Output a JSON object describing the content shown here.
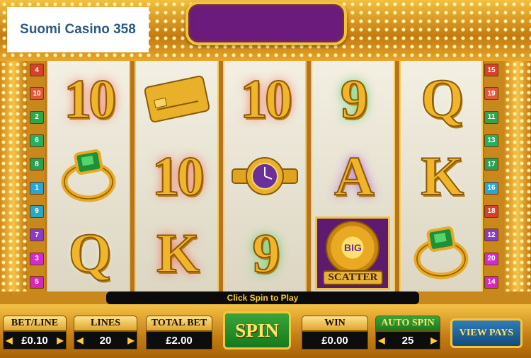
{
  "brand": "Suomi Casino 358",
  "lines_left": [
    {
      "n": "4",
      "color": "#d9402c"
    },
    {
      "n": "10",
      "color": "#e05a3a"
    },
    {
      "n": "2",
      "color": "#2ca84a"
    },
    {
      "n": "6",
      "color": "#24b060"
    },
    {
      "n": "8",
      "color": "#2aa050"
    },
    {
      "n": "1",
      "color": "#2aa6d6"
    },
    {
      "n": "9",
      "color": "#2aa6c6"
    },
    {
      "n": "7",
      "color": "#8a3cc8"
    },
    {
      "n": "3",
      "color": "#d42ad4"
    },
    {
      "n": "5",
      "color": "#d42ab8"
    }
  ],
  "lines_right": [
    {
      "n": "15",
      "color": "#d9402c"
    },
    {
      "n": "19",
      "color": "#e05a3a"
    },
    {
      "n": "11",
      "color": "#2ca84a"
    },
    {
      "n": "13",
      "color": "#24b060"
    },
    {
      "n": "17",
      "color": "#2aa050"
    },
    {
      "n": "16",
      "color": "#2aa6d6"
    },
    {
      "n": "18",
      "color": "#d9402c"
    },
    {
      "n": "12",
      "color": "#8a3cc8"
    },
    {
      "n": "20",
      "color": "#d42ad4"
    },
    {
      "n": "14",
      "color": "#d42ab8"
    }
  ],
  "reels": [
    [
      {
        "sym": "10",
        "glow": "red"
      },
      {
        "sym": "ring"
      },
      {
        "sym": "Q",
        "glow": ""
      }
    ],
    [
      {
        "sym": "card"
      },
      {
        "sym": "10",
        "glow": "red"
      },
      {
        "sym": "K",
        "glow": "red"
      }
    ],
    [
      {
        "sym": "10",
        "glow": "red"
      },
      {
        "sym": "watch"
      },
      {
        "sym": "9",
        "glow": "green"
      }
    ],
    [
      {
        "sym": "9",
        "glow": "green"
      },
      {
        "sym": "A",
        "glow": "purple"
      },
      {
        "sym": "scatter"
      }
    ],
    [
      {
        "sym": "Q",
        "glow": ""
      },
      {
        "sym": "K",
        "glow": ""
      },
      {
        "sym": "ring"
      }
    ]
  ],
  "scatter": {
    "disc": "BIG",
    "label": "SCATTER"
  },
  "status": "Click Spin to Play",
  "controls": {
    "bet_line": {
      "label": "BET/LINE",
      "value": "£0.10"
    },
    "lines": {
      "label": "LINES",
      "value": "20"
    },
    "total_bet": {
      "label": "TOTAL BET",
      "value": "£2.00"
    },
    "spin": "SPIN",
    "win": {
      "label": "WIN",
      "value": "£0.00"
    },
    "auto_spin": {
      "label": "AUTO SPIN",
      "value": "25"
    },
    "view_pays": "VIEW PAYS"
  }
}
